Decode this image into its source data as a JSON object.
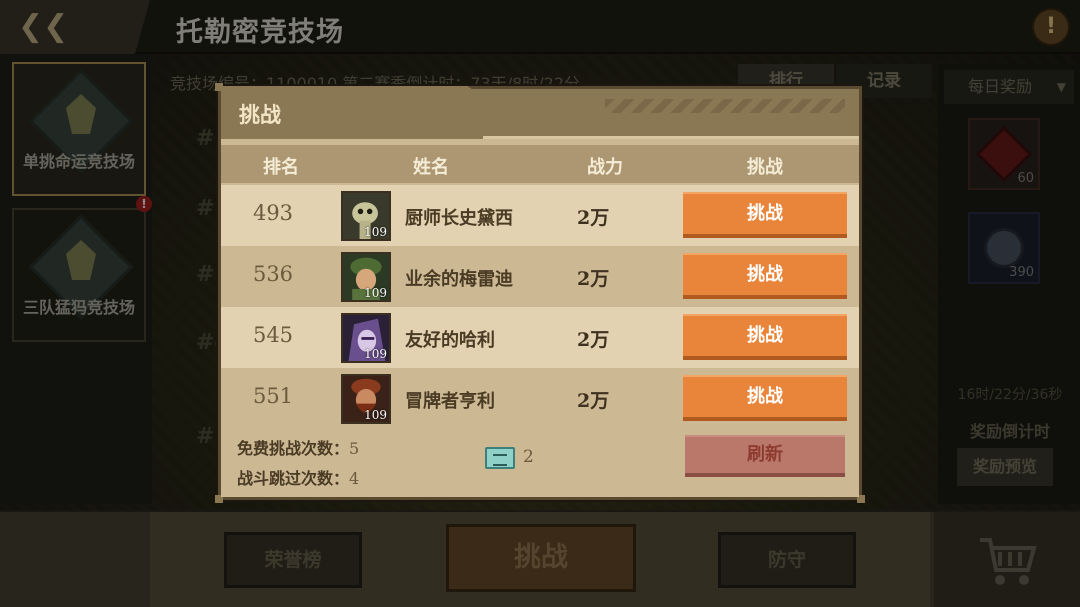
{
  "header": {
    "title": "托勒密竞技场",
    "help_icon": "!"
  },
  "arena_tabs": [
    {
      "label": "单挑命运竞技场",
      "selected": true
    },
    {
      "label": "三队猛犸竞技场",
      "selected": false,
      "alert": "!"
    }
  ],
  "background": {
    "info_text": "竞技场编号：1100010   第二赛季倒计时：73天/8时/22分",
    "rank_button": "排行",
    "record_button": "记录",
    "rank_ghosts": [
      "#1",
      "#2",
      "#3",
      "#4",
      "#5"
    ]
  },
  "right_panel": {
    "daily_select": "每日奖励",
    "rewards": [
      {
        "count": "60"
      },
      {
        "count": "390"
      }
    ],
    "timer": "16时/22分/36秒",
    "timer_label": "奖励倒计时",
    "preview_button": "奖励预览"
  },
  "bottom_nav": {
    "honor_button": "荣誉榜",
    "challenge_button": "挑战",
    "defense_button": "防守"
  },
  "modal": {
    "title": "挑战",
    "columns": {
      "rank": "排名",
      "name": "姓名",
      "power": "战力",
      "challenge": "挑战"
    },
    "opponents": [
      {
        "rank": "493",
        "name": "厨师长史黛西",
        "level": "109",
        "power": "2万",
        "button": "挑战",
        "avatar_icon": "slime-chef-icon"
      },
      {
        "rank": "536",
        "name": "业余的梅雷迪",
        "level": "109",
        "power": "2万",
        "button": "挑战",
        "avatar_icon": "soldier-icon"
      },
      {
        "rank": "545",
        "name": "友好的哈利",
        "level": "109",
        "power": "2万",
        "button": "挑战",
        "avatar_icon": "purple-hood-icon"
      },
      {
        "rank": "551",
        "name": "冒牌者亨利",
        "level": "109",
        "power": "2万",
        "button": "挑战",
        "avatar_icon": "bearded-man-icon"
      }
    ],
    "footer": {
      "free_label": "免费挑战次数：",
      "free_count": "5",
      "skip_label": "战斗跳过次数：",
      "skip_count": "4",
      "ticket_count": "2",
      "refresh_button": "刷新"
    }
  },
  "colors": {
    "challenge_orange": "#e9853b",
    "refresh_red": "#b9786a",
    "modal_bg": "#cdb894",
    "modal_header": "#8a7754"
  }
}
